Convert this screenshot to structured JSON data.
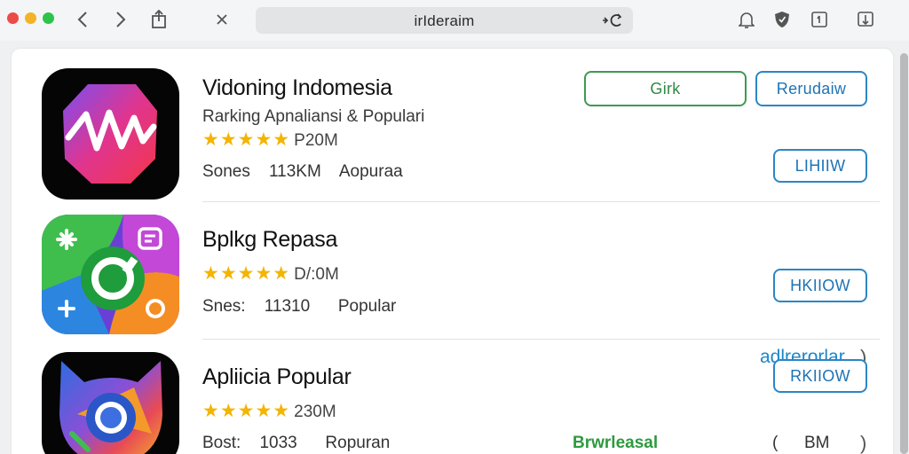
{
  "browser": {
    "url": "irIderaim",
    "icons": [
      "back-icon",
      "forward-icon",
      "share-icon",
      "close-icon",
      "reload-icon",
      "bell-icon",
      "shield-icon",
      "info-icon",
      "download-icon"
    ]
  },
  "apps": [
    {
      "title": "Vidoning Indomesia",
      "subtitle": "Rarking Apnaliansi & Populari",
      "stars": "★★★★★",
      "rating_meta": "P20M",
      "meta_label": "Sones",
      "meta_value": "113KM",
      "meta_extra": "Aopuraa",
      "button_green": "Girk",
      "button_blue_top": "Rerudaiw",
      "button_blue_bottom": "LIHIIW"
    },
    {
      "title": "Bplkg Repasa",
      "stars": "★★★★★",
      "rating_meta": "D/:0M",
      "meta_label": "Snes:",
      "meta_value": "11310",
      "meta_extra": "Popular",
      "button_blue": "HKIIOW",
      "link_blue": "adlrerorlar",
      "chevron": ")"
    },
    {
      "title": "Apliicia Popular",
      "stars": "★★★★★",
      "rating_meta": "230M",
      "meta_label": "Bost:",
      "meta_value": "1033",
      "meta_extra": "Ropuran",
      "button_blue": "RKIIOW",
      "link_green": "Brwrleasal",
      "paren_open": "(",
      "size": "BM",
      "chevron": ")"
    }
  ],
  "colors": {
    "accent_blue": "#2b86c5",
    "accent_green": "#3c9b4f",
    "star": "#f4b400"
  }
}
